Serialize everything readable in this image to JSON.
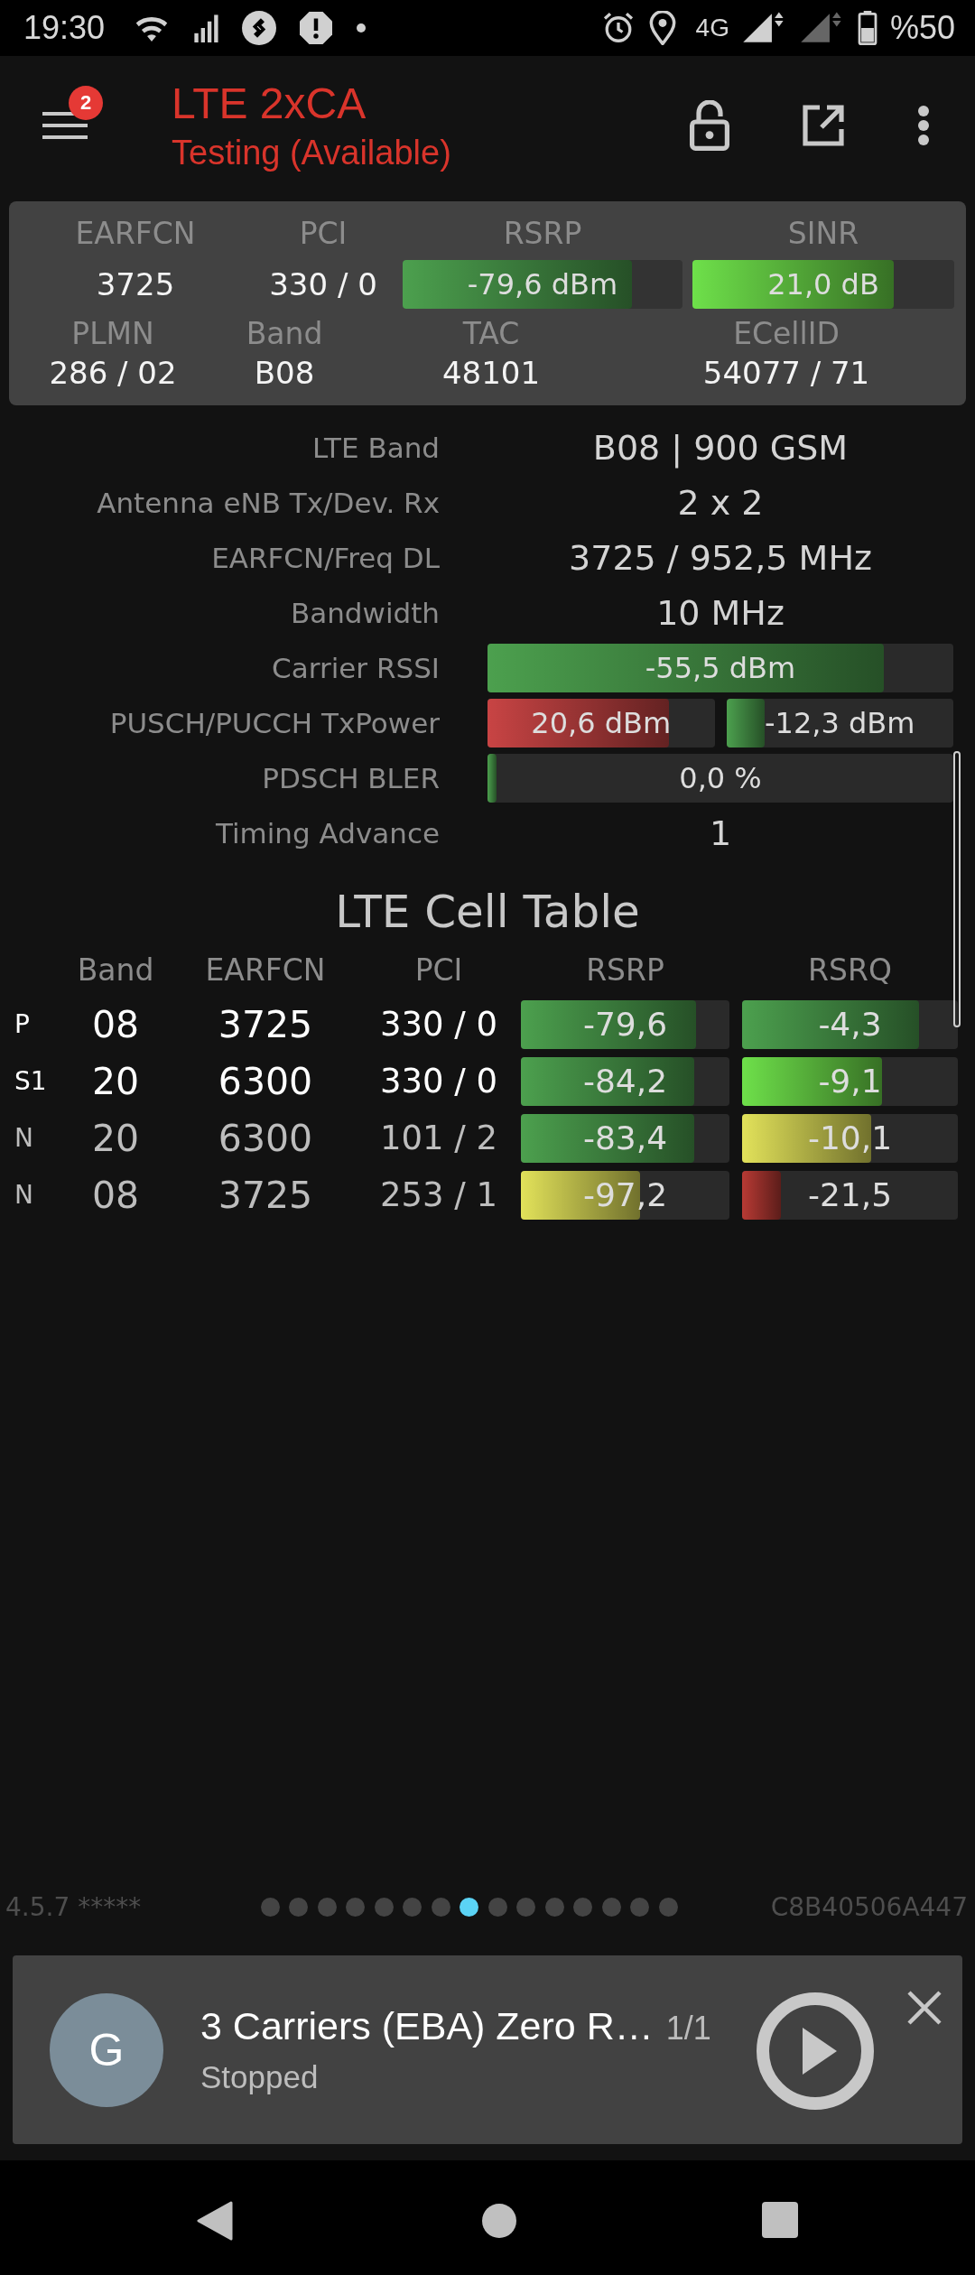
{
  "status_bar": {
    "time": "19:30",
    "network": "4G",
    "battery": "%50"
  },
  "app_bar": {
    "badge": "2",
    "title": "LTE 2xCA",
    "subtitle": "Testing (Available)"
  },
  "summary": {
    "row_1": [
      {
        "kind": "text",
        "label": "EARFCN",
        "value": "3725"
      },
      {
        "kind": "text",
        "label": "PCI",
        "value": "330 / 0"
      },
      {
        "kind": "meter",
        "label": "RSRP",
        "reading": "-79,6 dBm",
        "level": 0.82,
        "color": "#4ca04e"
      },
      {
        "kind": "meter",
        "label": "SINR",
        "reading": "21,0 dB",
        "level": 0.77,
        "color": "#6ee04a"
      }
    ],
    "row_2": [
      {
        "label": "PLMN",
        "value": "286 / 02"
      },
      {
        "label": "Band",
        "value": "B08"
      },
      {
        "label": "TAC",
        "value": "48101"
      },
      {
        "label": "ECellID",
        "value": "54077 / 71"
      }
    ]
  },
  "info_rows": [
    {
      "kind": "text",
      "label": "LTE Band",
      "value": "B08 | 900 GSM"
    },
    {
      "kind": "text",
      "label": "Antenna eNB Tx/Dev. Rx",
      "value": "2 x 2"
    },
    {
      "kind": "text",
      "label": "EARFCN/Freq DL",
      "value": "3725 / 952,5 MHz"
    },
    {
      "kind": "text",
      "label": "Bandwidth",
      "value": "10 MHz"
    },
    {
      "kind": "meter",
      "label": "Carrier RSSI",
      "meters": [
        {
          "reading": "-55,5 dBm",
          "level": 0.85,
          "color": "#4ca04e"
        }
      ]
    },
    {
      "kind": "meter",
      "label": "PUSCH/PUCCH TxPower",
      "meters": [
        {
          "reading": "20,6 dBm",
          "level": 0.8,
          "color": "#c84444"
        },
        {
          "reading": "-12,3 dBm",
          "level": 0.17,
          "color": "#4ca04e"
        }
      ]
    },
    {
      "kind": "meter",
      "label": "PDSCH BLER",
      "meters": [
        {
          "reading": "0,0 %",
          "level": 0.02,
          "color": "#4ca04e"
        }
      ]
    },
    {
      "kind": "text",
      "label": "Timing Advance",
      "value": "1"
    }
  ],
  "cell_table": {
    "title": "LTE Cell Table",
    "columns": [
      "Band",
      "EARFCN",
      "PCI",
      "RSRP",
      "RSRQ"
    ],
    "rows": [
      {
        "kind": "serving",
        "type": "P",
        "band": "08",
        "earfcn": "3725",
        "pci": "330 / 0",
        "rsrp": {
          "reading": "-79,6",
          "level": 0.84,
          "color": "#4ca04e"
        },
        "rsrq": {
          "reading": "-4,3",
          "level": 0.82,
          "color": "#4ca04e"
        }
      },
      {
        "kind": "serving",
        "type": "S1",
        "band": "20",
        "earfcn": "6300",
        "pci": "330 / 0",
        "rsrp": {
          "reading": "-84,2",
          "level": 0.83,
          "color": "#4ca04e"
        },
        "rsrq": {
          "reading": "-9,1",
          "level": 0.65,
          "color": "#6ee04a"
        }
      },
      {
        "kind": "neighbor",
        "type": "N",
        "band": "20",
        "earfcn": "6300",
        "pci": "101 / 2",
        "rsrp": {
          "reading": "-83,4",
          "level": 0.83,
          "color": "#4ca04e"
        },
        "rsrq": {
          "reading": "-10,1",
          "level": 0.6,
          "color": "#e2e25a"
        }
      },
      {
        "kind": "neighbor",
        "type": "N",
        "band": "08",
        "earfcn": "3725",
        "pci": "253 / 1",
        "rsrp": {
          "reading": "-97,2",
          "level": 0.57,
          "color": "#e2e25a"
        },
        "rsrq": {
          "reading": "-21,5",
          "level": 0.18,
          "color": "#b83a34"
        }
      }
    ]
  },
  "footer": {
    "version": "4.5.7 *****",
    "pages": [
      {
        "selected": false
      },
      {
        "selected": false
      },
      {
        "selected": false
      },
      {
        "selected": false
      },
      {
        "selected": false
      },
      {
        "selected": false
      },
      {
        "selected": false
      },
      {
        "selected": true
      },
      {
        "selected": false
      },
      {
        "selected": false
      },
      {
        "selected": false
      },
      {
        "selected": false
      },
      {
        "selected": false
      },
      {
        "selected": false
      },
      {
        "selected": false
      }
    ],
    "device_id": "C8B40506A447"
  },
  "player": {
    "avatar": "G",
    "title": "3 Carriers (EBA) Zero R…",
    "count": "1/1",
    "status": "Stopped"
  }
}
